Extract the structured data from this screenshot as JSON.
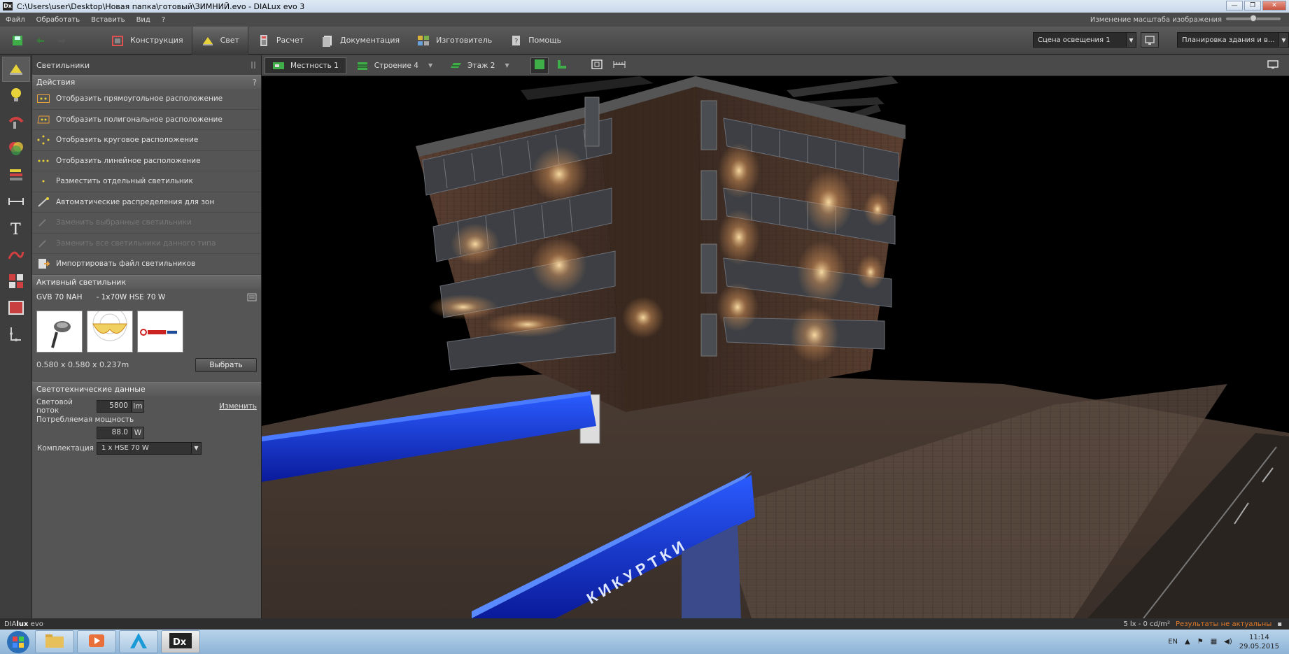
{
  "window": {
    "title": "C:\\Users\\user\\Desktop\\Новая папка\\готовый\\ЗИМНИЙ.evo - DIALux evo 3",
    "app_icon_text": "Dx"
  },
  "menu": {
    "items": [
      "Файл",
      "Обработать",
      "Вставить",
      "Вид",
      "?"
    ],
    "zoom_label": "Изменение масштаба изображения"
  },
  "toolbar": {
    "tabs": [
      {
        "label": "Конструкция",
        "icon": "construction-icon"
      },
      {
        "label": "Свет",
        "icon": "light-icon",
        "active": true
      },
      {
        "label": "Расчет",
        "icon": "calculator-icon"
      },
      {
        "label": "Документация",
        "icon": "document-icon"
      },
      {
        "label": "Изготовитель",
        "icon": "manufacturer-icon"
      },
      {
        "label": "Помощь",
        "icon": "help-icon"
      }
    ],
    "scene_dropdown": "Сцена освещения 1",
    "plan_dropdown": "Планировка здания и в..."
  },
  "panel": {
    "header": "Светильники",
    "actions_title": "Действия",
    "actions": [
      {
        "label": "Отобразить прямоугольное расположение",
        "enabled": true
      },
      {
        "label": "Отобразить полигональное расположение",
        "enabled": true
      },
      {
        "label": "Отобразить круговое расположение",
        "enabled": true
      },
      {
        "label": "Отобразить линейное расположение",
        "enabled": true
      },
      {
        "label": "Разместить отдельный светильник",
        "enabled": true
      },
      {
        "label": "Автоматические распределения для зон",
        "enabled": true
      },
      {
        "label": "Заменить выбранные светильники",
        "enabled": false
      },
      {
        "label": "Заменить все светильники данного типа",
        "enabled": false
      },
      {
        "label": "Импортировать файл светильников",
        "enabled": true
      }
    ],
    "active_title": "Активный светильник",
    "lum_name": "GVB 70 NAH",
    "lum_lamp": "- 1x70W HSE 70 W",
    "lum_dims": "0.580 x 0.580 x 0.237m",
    "select_button": "Выбрать",
    "photometric_title": "Светотехнические данные",
    "flux_label": "Световой поток",
    "flux_value": "5800",
    "flux_unit": "lm",
    "change_link": "Изменить",
    "power_label": "Потребляемая мощность",
    "power_value": "88.0",
    "power_unit": "W",
    "equip_label": "Комплектация",
    "equip_value": "1 x HSE 70 W"
  },
  "viewbar": {
    "tabs": [
      {
        "label": "Местность 1",
        "active": true
      },
      {
        "label": "Строение 4",
        "active": false
      },
      {
        "label": "Этаж 2",
        "active": false
      }
    ]
  },
  "scene": {
    "sign_text": "К И   К У Р Т К И"
  },
  "status": {
    "brand_pre": "DIA",
    "brand_bold": "lux",
    "brand_post": " evo",
    "readout": "5 lx - 0 cd/m²",
    "warning": "Результаты не актуальны"
  },
  "taskbar": {
    "lang": "EN",
    "time": "11:14",
    "date": "29.05.2015"
  }
}
